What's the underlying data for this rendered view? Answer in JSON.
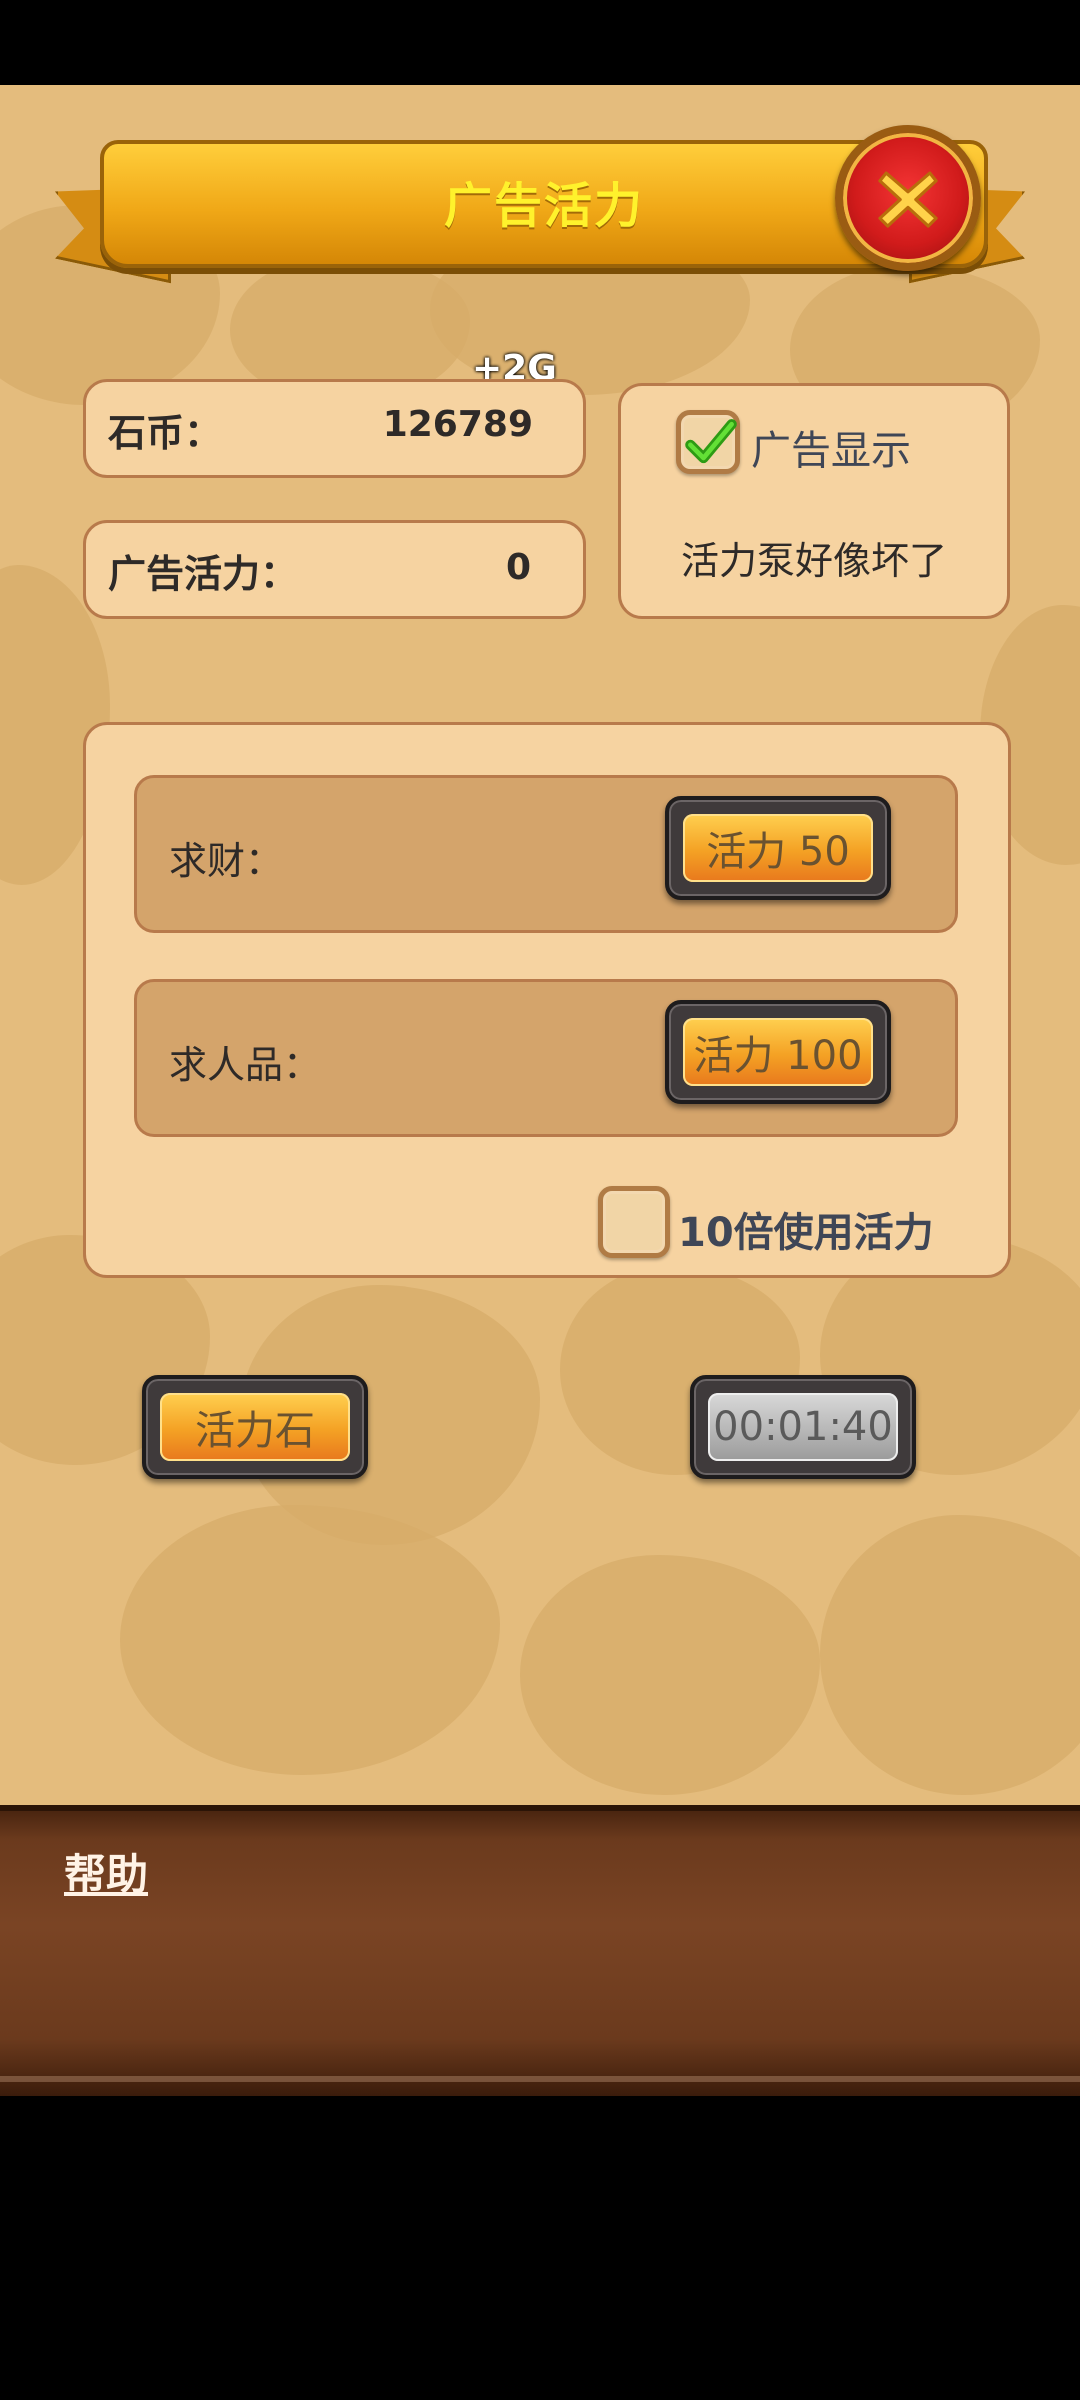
{
  "header": {
    "title": "广告活力"
  },
  "stats": {
    "stone_coin": {
      "label": "石币：",
      "value": "126789",
      "delta": "+2G"
    },
    "ad_energy": {
      "label": "广告活力：",
      "value": "0"
    }
  },
  "ad_panel": {
    "checkbox_label": "广告显示",
    "status_text": "活力泵好像坏了",
    "checked": true
  },
  "actions": [
    {
      "label": "求财：",
      "button": "活力 50"
    },
    {
      "label": "求人品：",
      "button": "活力 100"
    }
  ],
  "multiplier": {
    "label": "10倍使用活力",
    "checked": false
  },
  "bottom_buttons": {
    "stone_button": "活力石",
    "timer": "00:01:40"
  },
  "help": {
    "link": "帮助"
  },
  "colors": {
    "accent_title": "#fff22c",
    "panel": "#f6d3a1",
    "background": "#e4bc7d",
    "help_bar": "#6b3a1d"
  }
}
